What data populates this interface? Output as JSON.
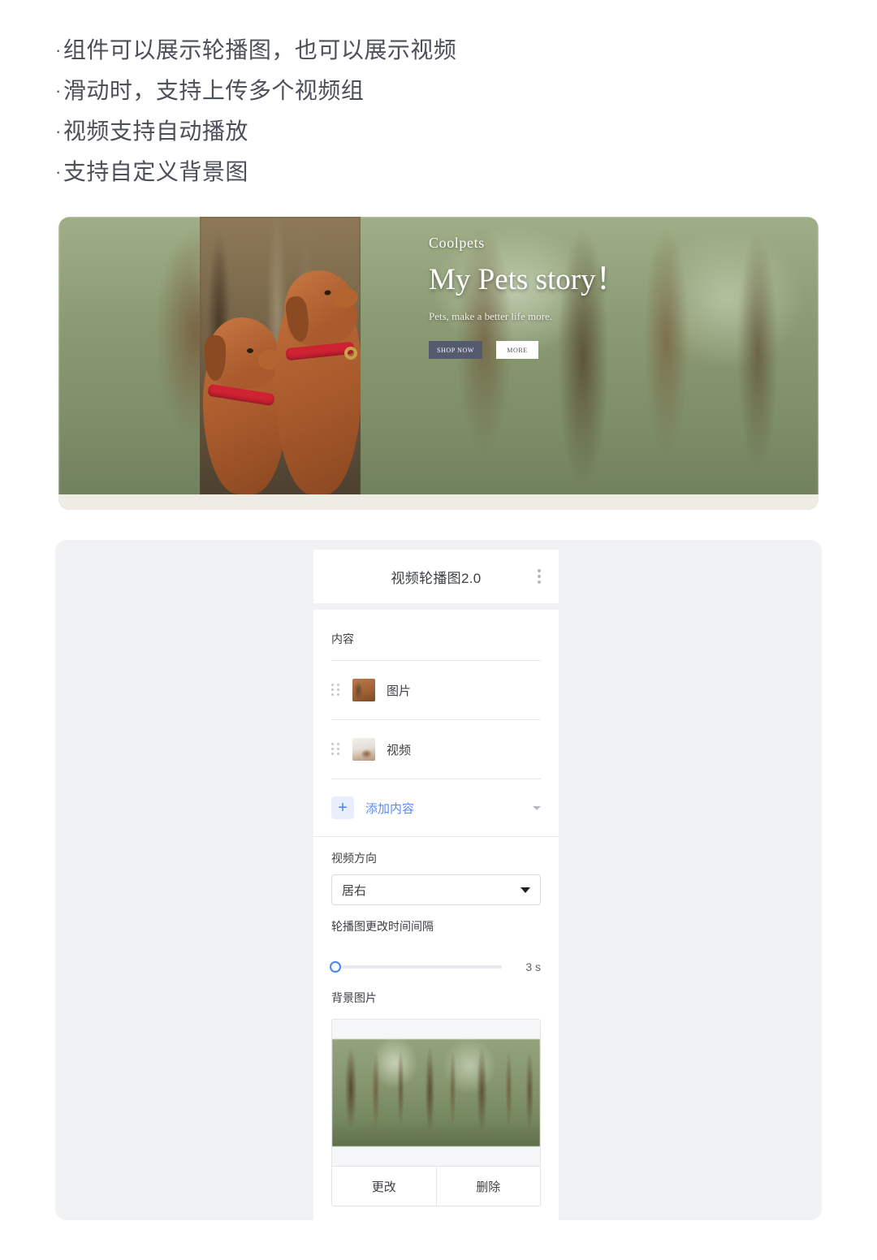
{
  "bullets": [
    "组件可以展示轮播图，也可以展示视频",
    "滑动时，支持上传多个视频组",
    "视频支持自动播放",
    "支持自定义背景图"
  ],
  "bullet_marker": "·",
  "banner": {
    "brand": "Coolpets",
    "title": "My Pets story！",
    "subtitle": "Pets, make a better life more.",
    "shop_button": "SHOP NOW",
    "more_button": "MORE",
    "background_alt": "forest-background",
    "dogs_photo_alt": "two-vizsla-dogs-photo",
    "video_thumb_alt": "couple-with-husky-living-room-video"
  },
  "settings": {
    "header_title": "视频轮播图2.0",
    "menu_icon": "kebab-menu-icon",
    "content_section_label": "内容",
    "content_items": [
      {
        "label": "图片",
        "thumb": "dog-image-thumb",
        "handle": "drag-handle-icon"
      },
      {
        "label": "视频",
        "thumb": "living-room-video-thumb",
        "handle": "drag-handle-icon"
      }
    ],
    "add_content": {
      "label": "添加内容",
      "plus_icon": "+",
      "caret_icon": "chevron-down-icon"
    },
    "video_direction": {
      "label": "视频方向",
      "value": "居右"
    },
    "interval": {
      "label": "轮播图更改时间间隔",
      "value_text": "3 s",
      "slider_percent": 0
    },
    "background_image": {
      "label": "背景图片",
      "preview_alt": "forest-background-preview",
      "change_button": "更改",
      "delete_button": "删除"
    }
  },
  "colors": {
    "accent_blue": "#4285f4",
    "accent_blue_soft": "#5b8def",
    "panel_grey": "#f1f2f4",
    "text_primary": "#3c4043",
    "text_muted": "#5f6368",
    "banner_floor": "#eeece4"
  }
}
